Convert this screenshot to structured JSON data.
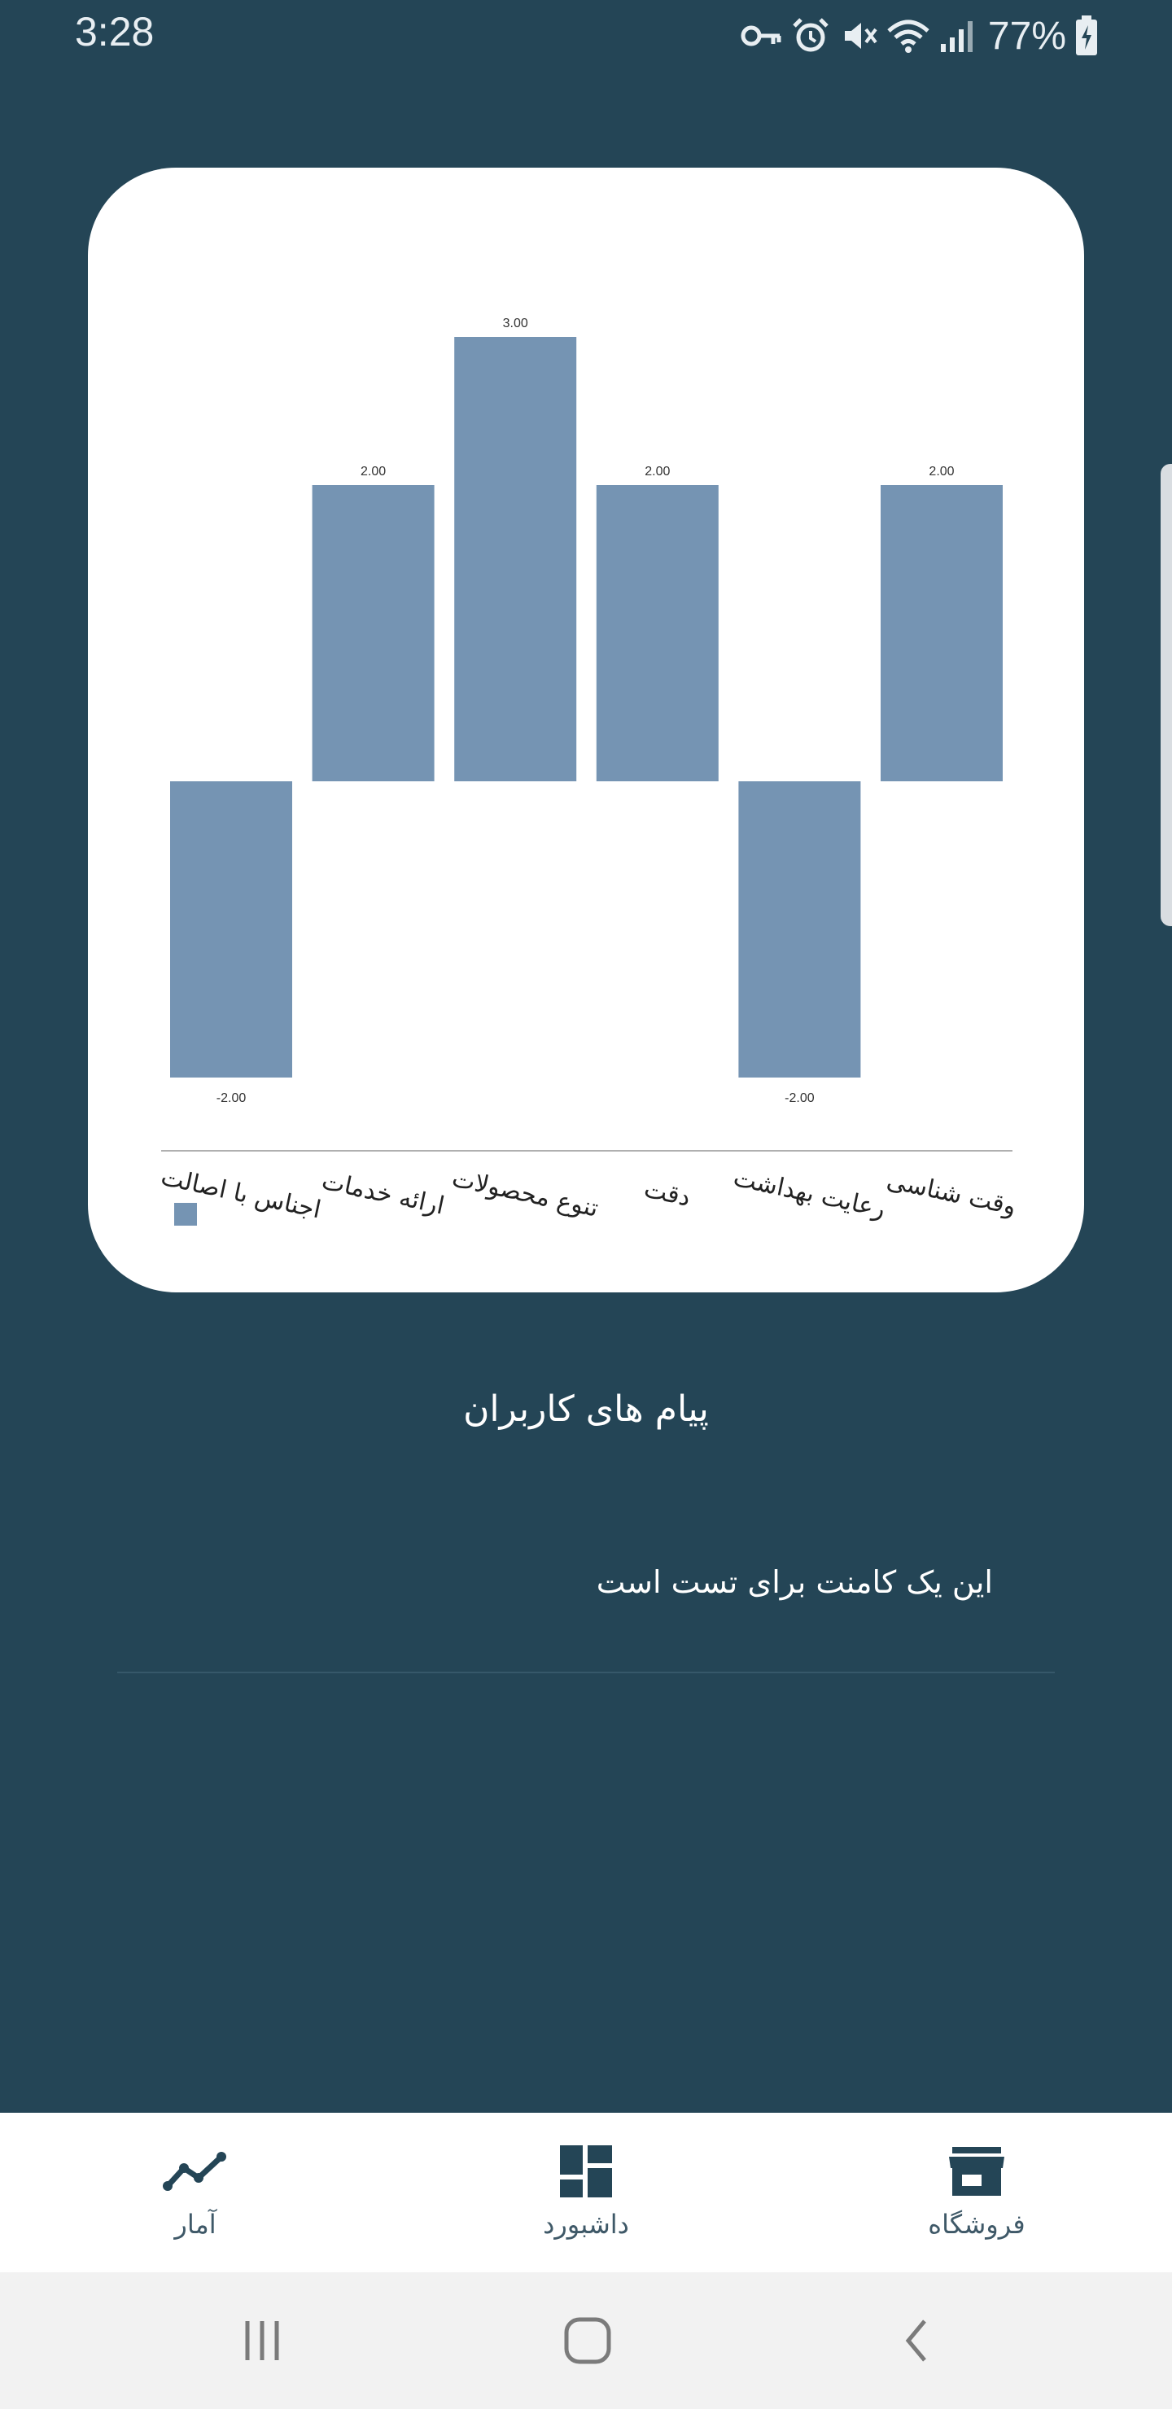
{
  "status_bar": {
    "time": "3:28",
    "battery_percent": "77%",
    "icons": [
      "vpn-key-icon",
      "alarm-icon",
      "mute-icon",
      "wifi-icon",
      "signal-icon",
      "battery-charging-icon"
    ]
  },
  "colors": {
    "background": "#244556",
    "bar": "#7594b3",
    "nav_icon": "#244556"
  },
  "chart_data": {
    "type": "bar",
    "categories": [
      "اجناس با اصالت",
      "ارائه خدمات",
      "تنوع محصولات",
      "دقت",
      "رعایت بهداشت",
      "وقت شناسی"
    ],
    "values": [
      -2,
      2,
      3,
      2,
      -2,
      2
    ],
    "value_labels": [
      "-2.00",
      "2.00",
      "3.00",
      "2.00",
      "-2.00",
      "2.00"
    ],
    "ylim": [
      -2,
      3
    ],
    "grid": false,
    "legend": "bottom-left"
  },
  "messages": {
    "title": "پیام های کاربران",
    "comments": [
      "این یک کامنت برای تست است"
    ]
  },
  "bottom_nav": {
    "items": [
      {
        "label": "آمار",
        "icon": "stats-line-icon"
      },
      {
        "label": "داشبورد",
        "icon": "dashboard-icon"
      },
      {
        "label": "فروشگاه",
        "icon": "store-icon"
      }
    ]
  },
  "system_nav": {
    "buttons": [
      "recent-apps-icon",
      "home-icon",
      "back-icon"
    ]
  }
}
